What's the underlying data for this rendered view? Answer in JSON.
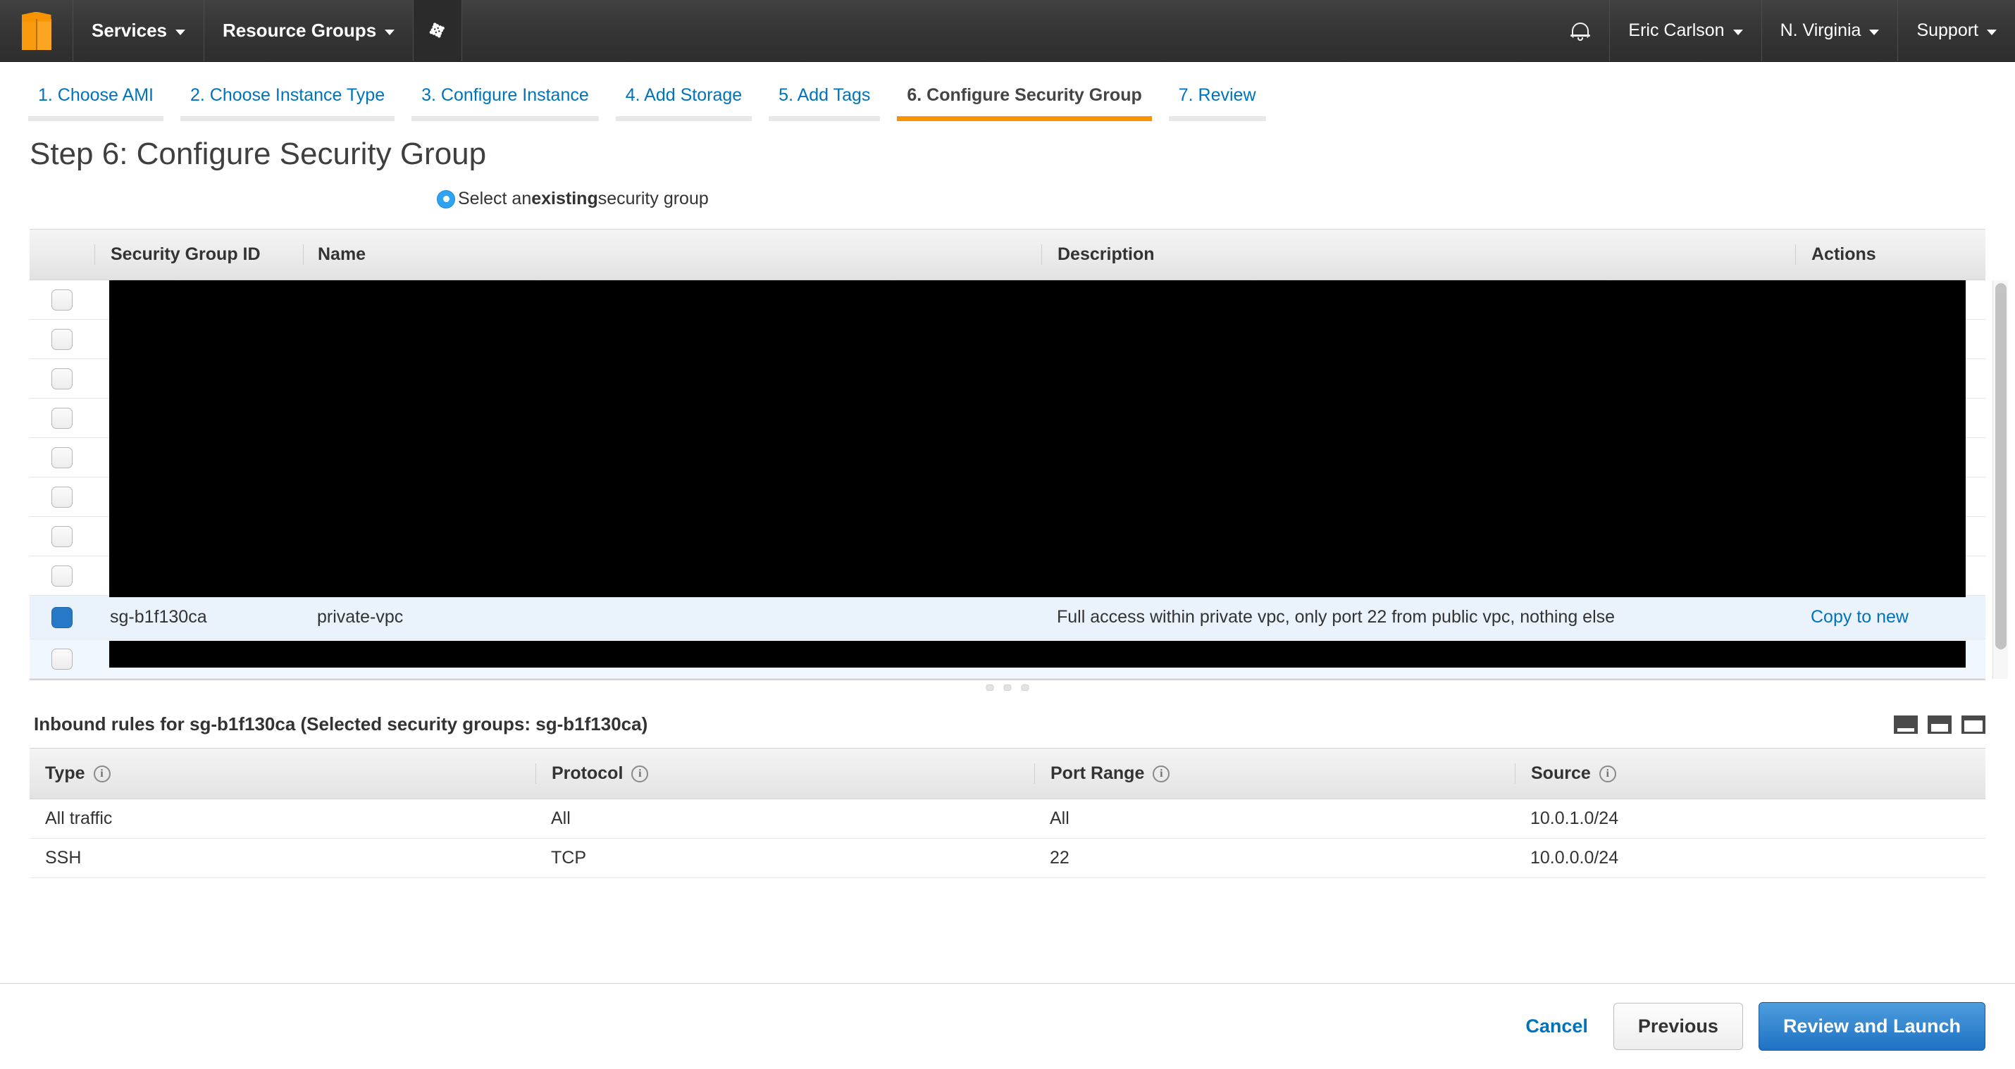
{
  "navbar": {
    "logo_icon": "aws-cube-icon",
    "services_label": "Services",
    "resource_groups_label": "Resource Groups",
    "pin_icon": "pin-icon",
    "bell_icon": "bell-icon",
    "account_label": "Eric Carlson",
    "region_label": "N. Virginia",
    "support_label": "Support"
  },
  "wizard": {
    "tabs": [
      {
        "label": "1. Choose AMI",
        "active": false
      },
      {
        "label": "2. Choose Instance Type",
        "active": false
      },
      {
        "label": "3. Configure Instance",
        "active": false
      },
      {
        "label": "4. Add Storage",
        "active": false
      },
      {
        "label": "5. Add Tags",
        "active": false
      },
      {
        "label": "6. Configure Security Group",
        "active": true
      },
      {
        "label": "7. Review",
        "active": false
      }
    ],
    "active_color": "#f79400"
  },
  "page": {
    "title": "Step 6: Configure Security Group",
    "radio_prefix": "Select an ",
    "radio_bold": "existing",
    "radio_suffix": " security group",
    "radio_selected": true,
    "radio_color": "#2ea3f2"
  },
  "security_groups_table": {
    "headers": {
      "id": "Security Group ID",
      "name": "Name",
      "description": "Description",
      "actions": "Actions"
    },
    "selected_row": {
      "id": "sg-b1f130ca",
      "name": "private-vpc",
      "description": "Full access within private vpc, only port 22 from public vpc, nothing else",
      "action_label": "Copy to new",
      "checked": true
    },
    "redacted_rows_above": 8,
    "redacted_rows_below": 1
  },
  "inbound": {
    "title": "Inbound rules for sg-b1f130ca (Selected security groups: sg-b1f130ca)",
    "view_icons": [
      "split-bottom-small-icon",
      "split-bottom-medium-icon",
      "split-bottom-large-icon"
    ],
    "headers": {
      "type": "Type",
      "protocol": "Protocol",
      "port_range": "Port Range",
      "source": "Source"
    },
    "rules": [
      {
        "type": "All traffic",
        "protocol": "All",
        "port_range": "All",
        "source": "10.0.1.0/24"
      },
      {
        "type": "SSH",
        "protocol": "TCP",
        "port_range": "22",
        "source": "10.0.0.0/24"
      }
    ]
  },
  "footer": {
    "cancel_label": "Cancel",
    "previous_label": "Previous",
    "launch_label": "Review and Launch",
    "primary_color": "#1f72c4"
  }
}
